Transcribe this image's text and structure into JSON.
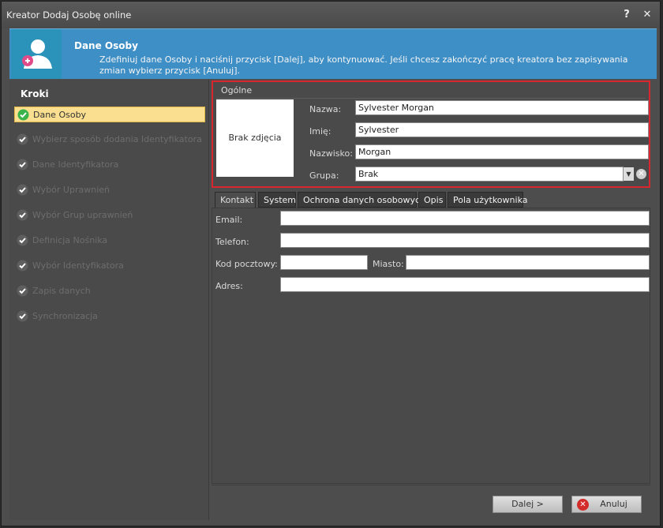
{
  "window": {
    "title": "Kreator Dodaj Osobę online",
    "help_glyph": "?",
    "close_glyph": "✕"
  },
  "banner": {
    "title": "Dane Osoby",
    "description": "Zdefiniuj dane Osoby i naciśnij przycisk [Dalej], aby kontynuować. Jeśli chcesz zakończyć pracę kreatora bez zapisywania zmian wybierz przycisk [Anuluj].",
    "icon": "add-person-icon",
    "color": "#3f8fc7"
  },
  "steps": {
    "title": "Kroki",
    "items": [
      {
        "label": "Dane Osoby",
        "active": true
      },
      {
        "label": "Wybierz sposób dodania Identyfikatora",
        "active": false
      },
      {
        "label": "Dane Identyfikatora",
        "active": false
      },
      {
        "label": "Wybór Uprawnień",
        "active": false
      },
      {
        "label": "Wybór Grup uprawnień",
        "active": false
      },
      {
        "label": "Definicja Nośnika",
        "active": false
      },
      {
        "label": "Wybór Identyfikatora",
        "active": false
      },
      {
        "label": "Zapis danych",
        "active": false
      },
      {
        "label": "Synchronizacja",
        "active": false
      }
    ]
  },
  "general": {
    "title": "Ogólne",
    "photo_placeholder": "Brak zdjęcia",
    "fields": {
      "nazwa": {
        "label": "Nazwa:",
        "value": "Sylvester Morgan"
      },
      "imie": {
        "label": "Imię:",
        "value": "Sylvester"
      },
      "nazwisko": {
        "label": "Nazwisko:",
        "value": "Morgan"
      },
      "grupa": {
        "label": "Grupa:",
        "value": "Brak"
      }
    },
    "highlight_color": "#d8262f"
  },
  "tabs": [
    "Kontakt",
    "System",
    "Ochrona danych osobowych",
    "Opis",
    "Pola użytkownika"
  ],
  "contact": {
    "email": {
      "label": "Email:",
      "value": ""
    },
    "telefon": {
      "label": "Telefon:",
      "value": ""
    },
    "kod": {
      "label": "Kod pocztowy:",
      "value": ""
    },
    "miasto": {
      "label": "Miasto:",
      "value": ""
    },
    "adres": {
      "label": "Adres:",
      "value": ""
    }
  },
  "footer": {
    "next_label": "Dalej >",
    "cancel_label": "Anuluj"
  }
}
